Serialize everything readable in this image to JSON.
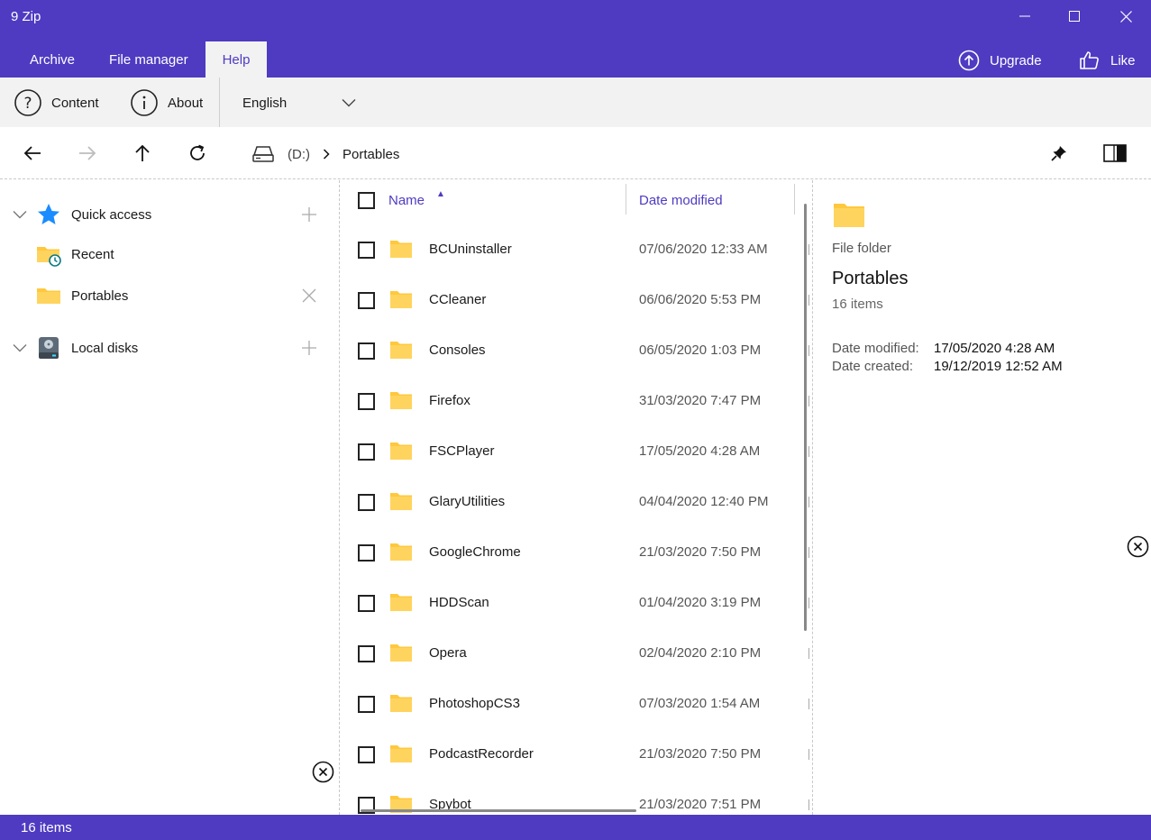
{
  "window": {
    "title": "9 Zip"
  },
  "ribbon_tabs": [
    {
      "label": "Archive",
      "active": false
    },
    {
      "label": "File manager",
      "active": false
    },
    {
      "label": "Help",
      "active": true
    }
  ],
  "top_actions": {
    "upgrade": "Upgrade",
    "like": "Like"
  },
  "ribbon": {
    "content": "Content",
    "about": "About",
    "language": "English"
  },
  "breadcrumb": {
    "drive": "(D:)",
    "folder": "Portables"
  },
  "sidebar": {
    "quick_access": "Quick access",
    "recent": "Recent",
    "portables": "Portables",
    "local_disks": "Local disks"
  },
  "columns": {
    "name": "Name",
    "date": "Date modified"
  },
  "files": [
    {
      "name": "BCUninstaller",
      "date": "07/06/2020 12:33 AM"
    },
    {
      "name": "CCleaner",
      "date": "06/06/2020 5:53 PM"
    },
    {
      "name": "Consoles",
      "date": "06/05/2020 1:03 PM"
    },
    {
      "name": "Firefox",
      "date": "31/03/2020 7:47 PM"
    },
    {
      "name": "FSCPlayer",
      "date": "17/05/2020 4:28 AM"
    },
    {
      "name": "GlaryUtilities",
      "date": "04/04/2020 12:40 PM"
    },
    {
      "name": "GoogleChrome",
      "date": "21/03/2020 7:50 PM"
    },
    {
      "name": "HDDScan",
      "date": "01/04/2020 3:19 PM"
    },
    {
      "name": "Opera",
      "date": "02/04/2020 2:10 PM"
    },
    {
      "name": "PhotoshopCS3",
      "date": "07/03/2020 1:54 AM"
    },
    {
      "name": "PodcastRecorder",
      "date": "21/03/2020 7:50 PM"
    },
    {
      "name": "Spybot",
      "date": "21/03/2020 7:51 PM"
    }
  ],
  "details": {
    "type": "File folder",
    "name": "Portables",
    "count": "16 items",
    "modified_label": "Date modified:",
    "modified_value": "17/05/2020 4:28 AM",
    "created_label": "Date created:",
    "created_value": "19/12/2019 12:52 AM"
  },
  "status": {
    "text": "16 items"
  },
  "colors": {
    "accent": "#4e3bc2",
    "folder": "#ffc83d",
    "star": "#1a8cff"
  }
}
